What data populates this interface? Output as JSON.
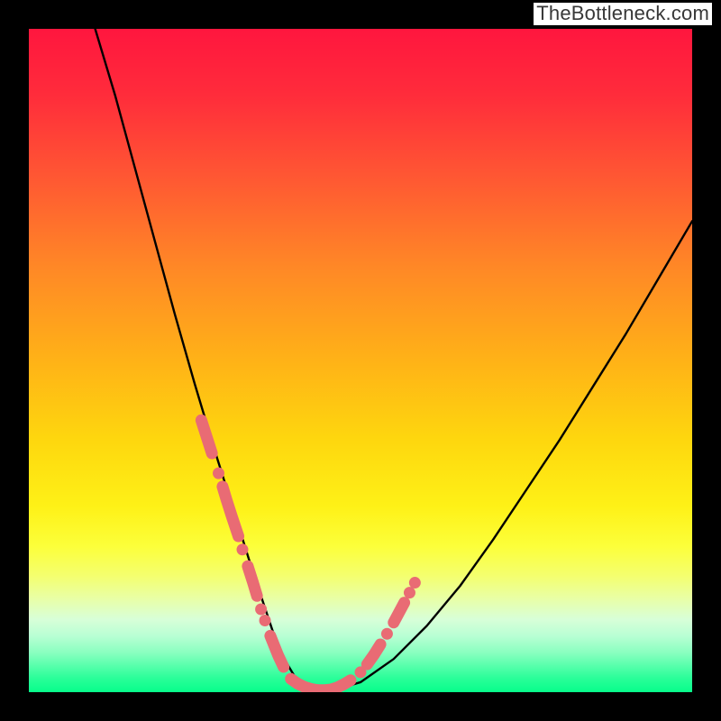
{
  "watermark": "TheBottleneck.com",
  "colors": {
    "frame": "#000000",
    "curve": "#000000",
    "necklace": "#e96b74",
    "gradient_top": "#ff163e",
    "gradient_bottom": "#07fd8b"
  },
  "chart_data": {
    "type": "line",
    "title": "",
    "xlabel": "",
    "ylabel": "",
    "xlim": [
      0,
      100
    ],
    "ylim": [
      0,
      100
    ],
    "grid": false,
    "legend": false,
    "axes_visible": false,
    "note": "Curve is a V/check-shaped bottleneck profile. Values estimated from pixel positions (no tick labels in image). y=0 is green bottom, y=100 is red top.",
    "series": [
      {
        "name": "bottleneck-curve",
        "x": [
          10,
          13,
          16,
          19,
          22,
          25,
          28,
          31,
          33.5,
          35.5,
          37,
          38.5,
          40,
          42,
          45,
          50,
          55,
          60,
          65,
          70,
          75,
          80,
          85,
          90,
          95,
          100
        ],
        "y": [
          100,
          90,
          79,
          68,
          57,
          46.5,
          36.5,
          27,
          19,
          13,
          8.5,
          5,
          2.5,
          1,
          0,
          1.5,
          5,
          10,
          16,
          23,
          30.5,
          38,
          46,
          54,
          62.5,
          71
        ]
      },
      {
        "name": "necklace-dots-left",
        "x": [
          26,
          26.8,
          27.6,
          28.6,
          29.2,
          29.8,
          30.6,
          31.6,
          32.2,
          33.0,
          33.8,
          34.4,
          35.0,
          35.6,
          36.4,
          37.0,
          37.6,
          38.4
        ],
        "y": [
          41,
          38.5,
          36,
          33,
          31,
          29,
          26.5,
          23.5,
          21.5,
          19,
          16.5,
          14.5,
          12.5,
          10.8,
          8.5,
          7,
          5.5,
          3.8
        ]
      },
      {
        "name": "necklace-floor",
        "x": [
          39.5,
          40.5,
          41.5,
          42.5,
          43.5,
          44.5,
          45.5,
          46.5,
          47.5,
          48.5
        ],
        "y": [
          2,
          1.3,
          0.8,
          0.5,
          0.3,
          0.3,
          0.4,
          0.7,
          1.2,
          1.8
        ]
      },
      {
        "name": "necklace-dots-right",
        "x": [
          50,
          51,
          52,
          53,
          54,
          55,
          55.8,
          56.6,
          57.4,
          58.2
        ],
        "y": [
          3,
          4.2,
          5.6,
          7.2,
          8.8,
          10.5,
          12,
          13.5,
          15,
          16.5
        ]
      }
    ]
  }
}
